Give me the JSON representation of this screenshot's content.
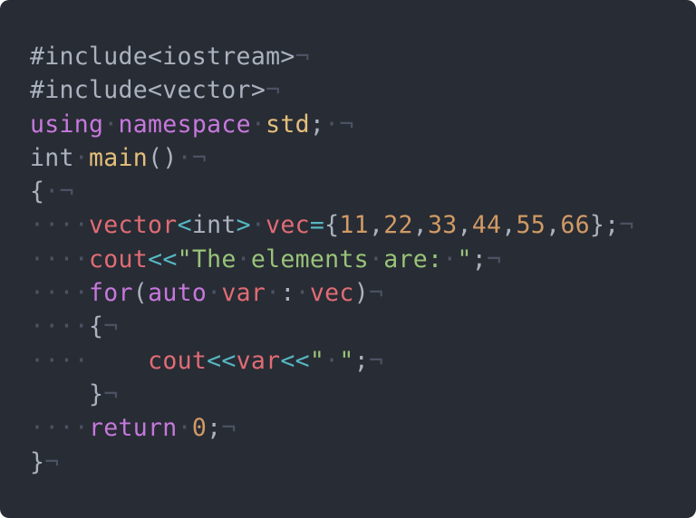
{
  "editor": {
    "background": "#282c34",
    "colors": {
      "default": "#abb2bf",
      "keyword": "#c678dd",
      "function": "#e5c07b",
      "identifier": "#e06c75",
      "operator": "#56b6c2",
      "string": "#98c379",
      "number": "#d19a66",
      "whitespace_marker": "#4b5263"
    },
    "lines": [
      [
        {
          "t": "tx",
          "v": "#include<iostream>"
        },
        {
          "t": "nl",
          "v": "¬"
        }
      ],
      [
        {
          "t": "tx",
          "v": "#include<vector>"
        },
        {
          "t": "nl",
          "v": "¬"
        }
      ],
      [
        {
          "t": "kw",
          "v": "using"
        },
        {
          "t": "ws",
          "v": "·"
        },
        {
          "t": "kw",
          "v": "namespace"
        },
        {
          "t": "ws",
          "v": "·"
        },
        {
          "t": "fn",
          "v": "std"
        },
        {
          "t": "tx",
          "v": ";"
        },
        {
          "t": "ws",
          "v": "·"
        },
        {
          "t": "nl",
          "v": "¬"
        }
      ],
      [
        {
          "t": "tx",
          "v": "int"
        },
        {
          "t": "ws",
          "v": "·"
        },
        {
          "t": "fn",
          "v": "main"
        },
        {
          "t": "tx",
          "v": "()"
        },
        {
          "t": "ws",
          "v": "·"
        },
        {
          "t": "nl",
          "v": "¬"
        }
      ],
      [
        {
          "t": "tx",
          "v": "{"
        },
        {
          "t": "ws",
          "v": "·"
        },
        {
          "t": "nl",
          "v": "¬"
        }
      ],
      [
        {
          "t": "ws",
          "v": "····"
        },
        {
          "t": "id",
          "v": "vector"
        },
        {
          "t": "op",
          "v": "<"
        },
        {
          "t": "tx",
          "v": "int"
        },
        {
          "t": "op",
          "v": ">"
        },
        {
          "t": "ws",
          "v": "·"
        },
        {
          "t": "id",
          "v": "vec"
        },
        {
          "t": "op",
          "v": "="
        },
        {
          "t": "tx",
          "v": "{"
        },
        {
          "t": "num",
          "v": "11"
        },
        {
          "t": "tx",
          "v": ","
        },
        {
          "t": "num",
          "v": "22"
        },
        {
          "t": "tx",
          "v": ","
        },
        {
          "t": "num",
          "v": "33"
        },
        {
          "t": "tx",
          "v": ","
        },
        {
          "t": "num",
          "v": "44"
        },
        {
          "t": "tx",
          "v": ","
        },
        {
          "t": "num",
          "v": "55"
        },
        {
          "t": "tx",
          "v": ","
        },
        {
          "t": "num",
          "v": "66"
        },
        {
          "t": "tx",
          "v": "};"
        },
        {
          "t": "nl",
          "v": "¬"
        }
      ],
      [
        {
          "t": "ws",
          "v": "····"
        },
        {
          "t": "id",
          "v": "cout"
        },
        {
          "t": "op",
          "v": "<<"
        },
        {
          "t": "str",
          "v": "\"The"
        },
        {
          "t": "ws",
          "v": "·"
        },
        {
          "t": "str",
          "v": "elements"
        },
        {
          "t": "ws",
          "v": "·"
        },
        {
          "t": "str",
          "v": "are:"
        },
        {
          "t": "ws",
          "v": "·"
        },
        {
          "t": "str",
          "v": "\""
        },
        {
          "t": "tx",
          "v": ";"
        },
        {
          "t": "nl",
          "v": "¬"
        }
      ],
      [
        {
          "t": "ws",
          "v": "····"
        },
        {
          "t": "kw",
          "v": "for"
        },
        {
          "t": "tx",
          "v": "("
        },
        {
          "t": "kw",
          "v": "auto"
        },
        {
          "t": "ws",
          "v": "·"
        },
        {
          "t": "id",
          "v": "var"
        },
        {
          "t": "ws",
          "v": "·"
        },
        {
          "t": "tx",
          "v": ":"
        },
        {
          "t": "ws",
          "v": "·"
        },
        {
          "t": "id",
          "v": "vec"
        },
        {
          "t": "tx",
          "v": ")"
        },
        {
          "t": "nl",
          "v": "¬"
        }
      ],
      [
        {
          "t": "ws",
          "v": "····"
        },
        {
          "t": "tx",
          "v": "{"
        },
        {
          "t": "nl",
          "v": "¬"
        }
      ],
      [
        {
          "t": "ws",
          "v": "····"
        },
        {
          "t": "tx",
          "v": "    "
        },
        {
          "t": "id",
          "v": "cout"
        },
        {
          "t": "op",
          "v": "<<"
        },
        {
          "t": "id",
          "v": "var"
        },
        {
          "t": "op",
          "v": "<<"
        },
        {
          "t": "str",
          "v": "\""
        },
        {
          "t": "ws",
          "v": "·"
        },
        {
          "t": "str",
          "v": "\""
        },
        {
          "t": "tx",
          "v": ";"
        },
        {
          "t": "nl",
          "v": "¬"
        }
      ],
      [
        {
          "t": "tx",
          "v": "    "
        },
        {
          "t": "tx",
          "v": "}"
        },
        {
          "t": "nl",
          "v": "¬"
        }
      ],
      [
        {
          "t": "ws",
          "v": "····"
        },
        {
          "t": "kw",
          "v": "return"
        },
        {
          "t": "ws",
          "v": "·"
        },
        {
          "t": "num",
          "v": "0"
        },
        {
          "t": "tx",
          "v": ";"
        },
        {
          "t": "nl",
          "v": "¬"
        }
      ],
      [
        {
          "t": "tx",
          "v": "}"
        },
        {
          "t": "nl",
          "v": "¬"
        }
      ]
    ]
  }
}
